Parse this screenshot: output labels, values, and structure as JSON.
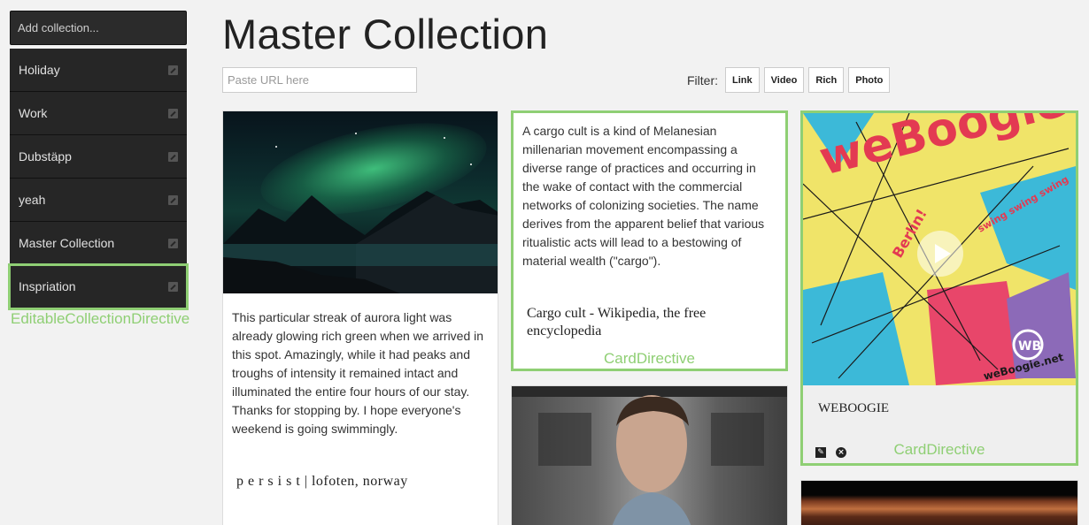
{
  "sidebar": {
    "add_placeholder": "Add collection...",
    "items": [
      {
        "label": "Holiday"
      },
      {
        "label": "Work"
      },
      {
        "label": "Dubstäpp"
      },
      {
        "label": "yeah"
      },
      {
        "label": "Master Collection"
      },
      {
        "label": "Inspriation"
      }
    ],
    "annotation": "EditableCollectionDirective"
  },
  "main": {
    "title": "Master Collection",
    "url_placeholder": "Paste URL here",
    "filter": {
      "label": "Filter:",
      "options": [
        "Link",
        "Video",
        "Rich",
        "Photo"
      ]
    }
  },
  "cards": {
    "aurora": {
      "description": "This particular streak of aurora light was already glowing rich green when we arrived in this spot. Amazingly, while it had peaks and troughs of intensity it remained intact and illuminated the entire four hours of our stay. Thanks for stopping by. I hope everyone's weekend is going swimmingly.",
      "source": "p e r s i s t | lofoten, norway"
    },
    "cargo": {
      "description": "A cargo cult is a kind of Melanesian millenarian movement encompassing a diverse range of practices and occurring in the wake of contact with the commercial networks of colonizing societies. The name derives from the apparent belief that various ritualistic acts will lead to a bestowing of material wealth (\"cargo\").",
      "source": "Cargo cult - Wikipedia, the free encyclopedia",
      "annotation": "CardDirective"
    },
    "weboogie": {
      "source": "WEBOOGIE",
      "annotation": "CardDirective",
      "artwork_text": {
        "brand": "weBoogie",
        "city": "Berlin!",
        "tagline": "swing swing swing",
        "logo": "WB",
        "url": "weBoogie.net"
      }
    }
  },
  "colors": {
    "accent": "#8fcf74",
    "sidebar_bg": "#262626",
    "page_bg": "#f2f2f2"
  }
}
